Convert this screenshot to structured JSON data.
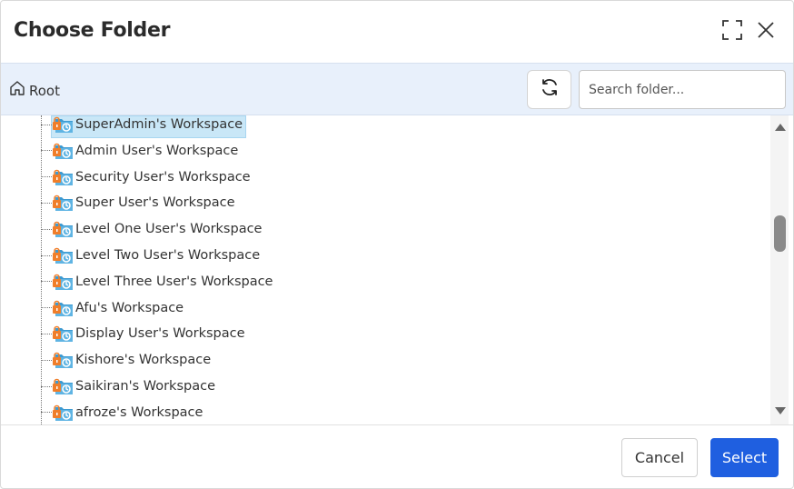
{
  "dialog": {
    "title": "Choose Folder",
    "maximize_icon": "maximize-icon",
    "close_icon": "close-icon"
  },
  "toolbar": {
    "root_label": "Root",
    "home_icon": "home-icon",
    "refresh_icon": "refresh-icon",
    "search_placeholder": "Search folder...",
    "search_value": ""
  },
  "tree": {
    "selected_index": 0,
    "folder_icon": "shared-locked-folder-icon",
    "items": [
      {
        "label": "SuperAdmin's Workspace"
      },
      {
        "label": "Admin User's Workspace"
      },
      {
        "label": "Security User's Workspace"
      },
      {
        "label": "Super User's Workspace"
      },
      {
        "label": "Level One User's Workspace"
      },
      {
        "label": "Level Two User's Workspace"
      },
      {
        "label": "Level Three User's Workspace"
      },
      {
        "label": "Afu's Workspace"
      },
      {
        "label": "Display User's Workspace"
      },
      {
        "label": "Kishore's Workspace"
      },
      {
        "label": "Saikiran's Workspace"
      },
      {
        "label": "afroze's Workspace"
      }
    ]
  },
  "footer": {
    "cancel_label": "Cancel",
    "select_label": "Select"
  },
  "colors": {
    "accent": "#1f5fe0",
    "toolbar_bg": "#e8f0fb",
    "selection_bg": "#c9e7f7",
    "folder_blue": "#3d9ad1",
    "lock_orange": "#f07e2a"
  }
}
